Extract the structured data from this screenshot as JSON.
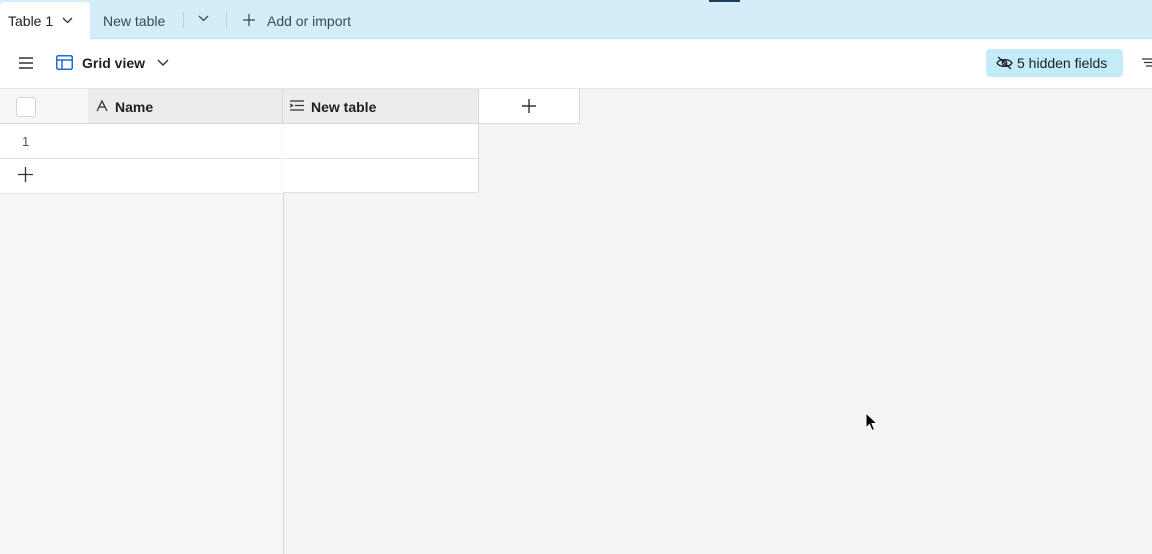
{
  "tabs": {
    "active": {
      "label": "Table 1"
    },
    "second": {
      "label": "New table"
    },
    "add_import_label": "Add or import"
  },
  "toolbar": {
    "view_label": "Grid view",
    "hidden_fields_label": "5 hidden fields"
  },
  "grid": {
    "columns": [
      {
        "label": "Name",
        "icon": "single-line-text-icon"
      },
      {
        "label": "New table",
        "icon": "long-text-icon"
      }
    ],
    "rows": [
      {
        "number": "1",
        "name": "",
        "new_table": ""
      }
    ]
  },
  "colors": {
    "tabbar": "#d3eef8",
    "hidden_fields_bg": "#c4ecf8",
    "accent_blue": "#1c6bd0"
  }
}
